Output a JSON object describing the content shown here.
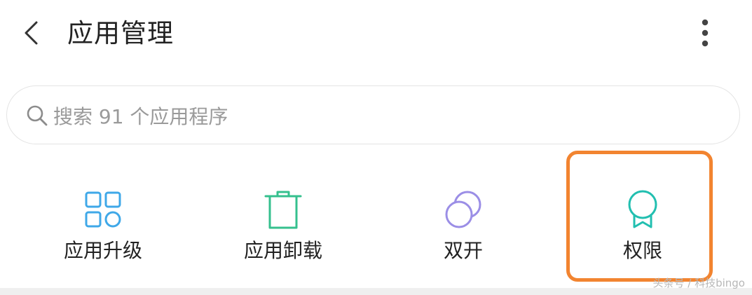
{
  "header": {
    "title": "应用管理",
    "back_icon": "chevron-left-icon",
    "more_icon": "more-vertical-icon"
  },
  "search": {
    "placeholder": "搜索 91 个应用程序",
    "value": "",
    "icon": "search-icon"
  },
  "actions": [
    {
      "label": "应用升级",
      "icon": "grid-apps-icon",
      "color": "#3fa8e8"
    },
    {
      "label": "应用卸载",
      "icon": "trash-icon",
      "color": "#35c08e"
    },
    {
      "label": "双开",
      "icon": "double-circle-icon",
      "color": "#9b8ee6"
    },
    {
      "label": "权限",
      "icon": "award-badge-icon",
      "color": "#22bfb0"
    }
  ],
  "highlight_color": "#f28430",
  "watermark": "头条号 / 科技bingo"
}
